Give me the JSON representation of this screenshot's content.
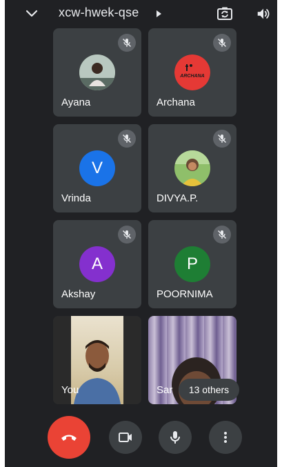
{
  "header": {
    "meeting_code": "xcw-hwek-qse"
  },
  "participants": [
    {
      "name": "Ayana",
      "avatar_type": "photo",
      "muted": true
    },
    {
      "name": "Archana",
      "avatar_type": "logo",
      "logo_text": "ARCHANA",
      "avatar_color": "#e53935",
      "muted": true
    },
    {
      "name": "Vrinda",
      "avatar_type": "letter",
      "initial": "V",
      "avatar_color": "#1a73e8",
      "muted": true
    },
    {
      "name": "DIVYA.P.",
      "avatar_type": "photo",
      "muted": true
    },
    {
      "name": "Akshay",
      "avatar_type": "letter",
      "initial": "A",
      "avatar_color": "#8430ce",
      "muted": true
    },
    {
      "name": "POORNIMA",
      "avatar_type": "letter",
      "initial": "P",
      "avatar_color": "#1e7e34",
      "muted": true
    },
    {
      "name": "You",
      "avatar_type": "video",
      "muted": false
    },
    {
      "name": "Sar",
      "avatar_type": "video",
      "muted": false
    }
  ],
  "others_chip": "13 others",
  "colors": {
    "background": "#202124",
    "tile": "#3c4043",
    "end_call": "#ea4335"
  },
  "controls": {
    "end_call_icon": "end-call-icon",
    "camera_icon": "video-camera-icon",
    "mic_icon": "microphone-icon",
    "more_icon": "more-vertical-icon"
  }
}
